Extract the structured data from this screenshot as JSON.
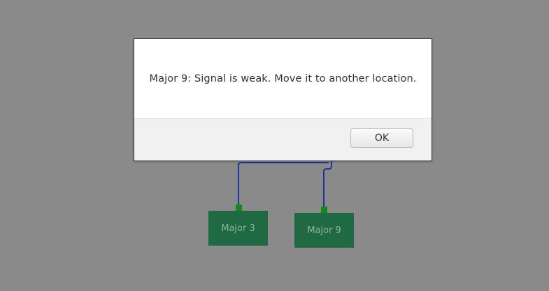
{
  "dialog": {
    "message": "Major 9: Signal is weak. Move it to another location.",
    "ok_label": "OK"
  },
  "nodes": [
    {
      "label": "Major 3"
    },
    {
      "label": "Major 9"
    }
  ],
  "colors": {
    "background": "#8a8a8a",
    "node_fill": "#1f6a42",
    "node_text": "#8fb39e",
    "port": "#138a13",
    "wire": "#1a3a9a"
  }
}
